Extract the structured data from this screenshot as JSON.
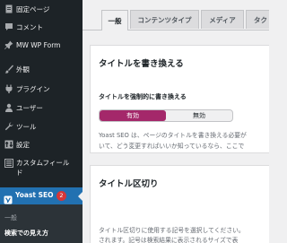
{
  "sidebar": {
    "items": [
      {
        "label": "固定ページ",
        "icon": "page-icon"
      },
      {
        "label": "コメント",
        "icon": "comment-icon"
      },
      {
        "label": "MW WP Form",
        "icon": "pin-icon"
      },
      {
        "label": "外観",
        "icon": "brush-icon"
      },
      {
        "label": "プラグイン",
        "icon": "plug-icon"
      },
      {
        "label": "ユーザー",
        "icon": "user-icon"
      },
      {
        "label": "ツール",
        "icon": "wrench-icon"
      },
      {
        "label": "設定",
        "icon": "settings-icon"
      },
      {
        "label": "カスタムフィール\nド",
        "icon": "grid-icon"
      }
    ],
    "active": {
      "label": "Yoast SEO",
      "badge": "2",
      "icon": "yoast-icon"
    },
    "submenu": [
      {
        "label": "一般"
      },
      {
        "label": "検索での見え方"
      }
    ]
  },
  "tabs": [
    {
      "label": "一般",
      "active": true
    },
    {
      "label": "コンテンツタイプ",
      "active": false
    },
    {
      "label": "メディア",
      "active": false
    },
    {
      "label": "タク",
      "active": false
    }
  ],
  "rewrite_card": {
    "title": "タイトルを書き換える",
    "field_label": "タイトルを強制的に書き換える",
    "options": [
      "有効",
      "無効"
    ],
    "selected": "有効",
    "desc_line1": "Yoast SEO は、ページのタイトルを書き換える必要が",
    "desc_line2": "いて、どう変更すればいいか知っているなら、ここで"
  },
  "separator_card": {
    "title": "タイトル区切り",
    "desc_line1": "タイトル区切りに使用する記号を選択してください。",
    "desc_line2": "されます。記号は検索結果に表示されるサイズで表"
  },
  "colors": {
    "sidebar_bg": "#1d2327",
    "active_blue": "#2271b1",
    "toggle_on": "#a4286a",
    "badge": "#d63638"
  }
}
